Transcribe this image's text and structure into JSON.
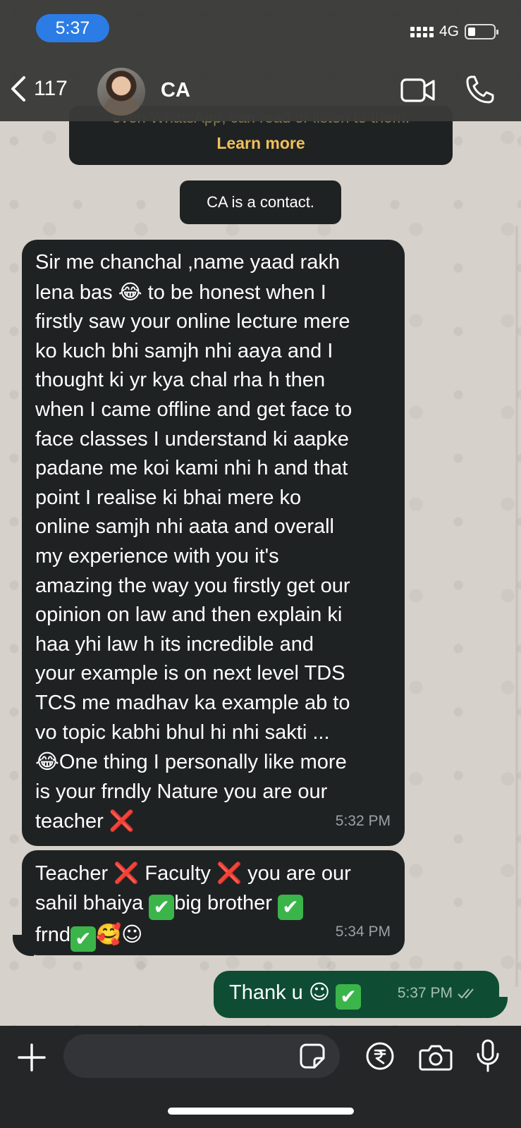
{
  "status_bar": {
    "time": "5:37",
    "network": "4G"
  },
  "header": {
    "back_count": "117",
    "contact_name": "CA",
    "icons": [
      "chevron-left-icon",
      "video-call-icon",
      "phone-icon"
    ]
  },
  "encryption_notice": {
    "partial_text": "even WhatsApp, can read or listen to them.",
    "learn_more": "Learn more"
  },
  "system_message": "CA is a contact.",
  "messages": [
    {
      "direction": "incoming",
      "text_parts": [
        "Sir me chanchal ,name yaad rakh\nlena bas ",
        "😂",
        " to be honest when I\nfirstly saw your online lecture mere\nko kuch bhi samjh nhi aaya and I\nthought ki yr kya chal rha h then\nwhen I came offline and get face to\nface classes I understand ki aapke\npadane me koi kami nhi h and that\npoint I realise ki bhai mere ko\nonline samjh nhi aata and overall\nmy experience with you it's\namazing the way you firstly get our\nopinion on law and then explain ki\nhaa yhi law h its incredible and\nyour example is on next level TDS\nTCS me madhav ka example ab to\nvo topic kabhi bhul hi nhi sakti ...\n",
        "😂",
        "One thing I personally like more\nis your frndly Nature you are our\nteacher ",
        "❌"
      ],
      "time": "5:32 PM"
    },
    {
      "direction": "incoming",
      "text_parts": [
        "Teacher ",
        "❌",
        " Faculty ",
        "❌",
        " you are our\nsahil bhaiya ",
        "✔",
        "big brother ",
        "✔",
        "\nfrnd",
        "✔",
        "🥰",
        "☺"
      ],
      "time": "5:34 PM"
    },
    {
      "direction": "outgoing",
      "text_parts": [
        "Thank u ",
        "☺",
        " ",
        "✔"
      ],
      "time": "5:37 PM",
      "read_status": "double-check-icon"
    }
  ],
  "composer": {
    "placeholder": "",
    "icons": [
      "plus-icon",
      "sticker-icon",
      "rupee-payment-icon",
      "camera-icon",
      "microphone-icon"
    ]
  },
  "colors": {
    "header_bg": "#3a3a38",
    "incoming_bubble": "#1f2223",
    "outgoing_bubble": "#0e4d34",
    "accent_link": "#f0c05a",
    "time_pill": "#2c7ce6"
  }
}
